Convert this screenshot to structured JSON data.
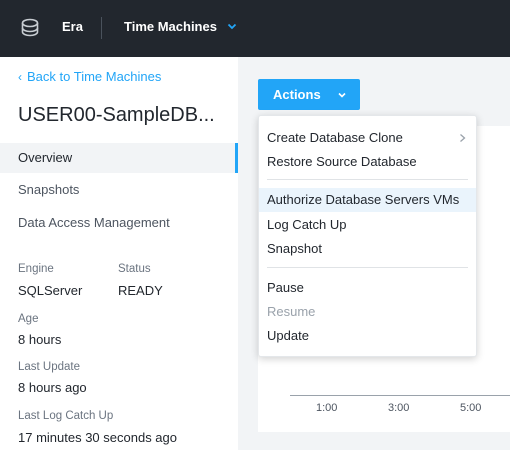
{
  "header": {
    "app_name": "Era",
    "section_name": "Time Machines",
    "logo_icon": "era-logo-icon",
    "section_chevron_icon": "chevron-down-icon"
  },
  "sidebar": {
    "back_link": "Back to Time Machines",
    "title": "USER00-SampleDB...",
    "nav": [
      {
        "label": "Overview",
        "active": true
      },
      {
        "label": "Snapshots",
        "active": false
      },
      {
        "label": "Data Access Management",
        "active": false
      }
    ],
    "properties": {
      "engine_label": "Engine",
      "engine_value": "SQLServer",
      "status_label": "Status",
      "status_value": "READY",
      "age_label": "Age",
      "age_value": "8 hours",
      "last_update_label": "Last Update",
      "last_update_value": "8 hours ago",
      "last_log_label": "Last Log Catch Up",
      "last_log_value": "17 minutes 30 seconds ago"
    }
  },
  "actions": {
    "button_label": "Actions",
    "menu": {
      "create_clone": "Create Database Clone",
      "restore_source": "Restore Source Database",
      "authorize_servers": "Authorize Database Servers VMs",
      "log_catch_up": "Log Catch Up",
      "snapshot": "Snapshot",
      "pause": "Pause",
      "resume": "Resume",
      "update": "Update"
    }
  },
  "timeline": {
    "ticks": [
      "1:00",
      "3:00",
      "5:00"
    ]
  },
  "colors": {
    "accent": "#22a5f7",
    "topbar": "#22272e",
    "highlight": "#eaf4fc"
  }
}
